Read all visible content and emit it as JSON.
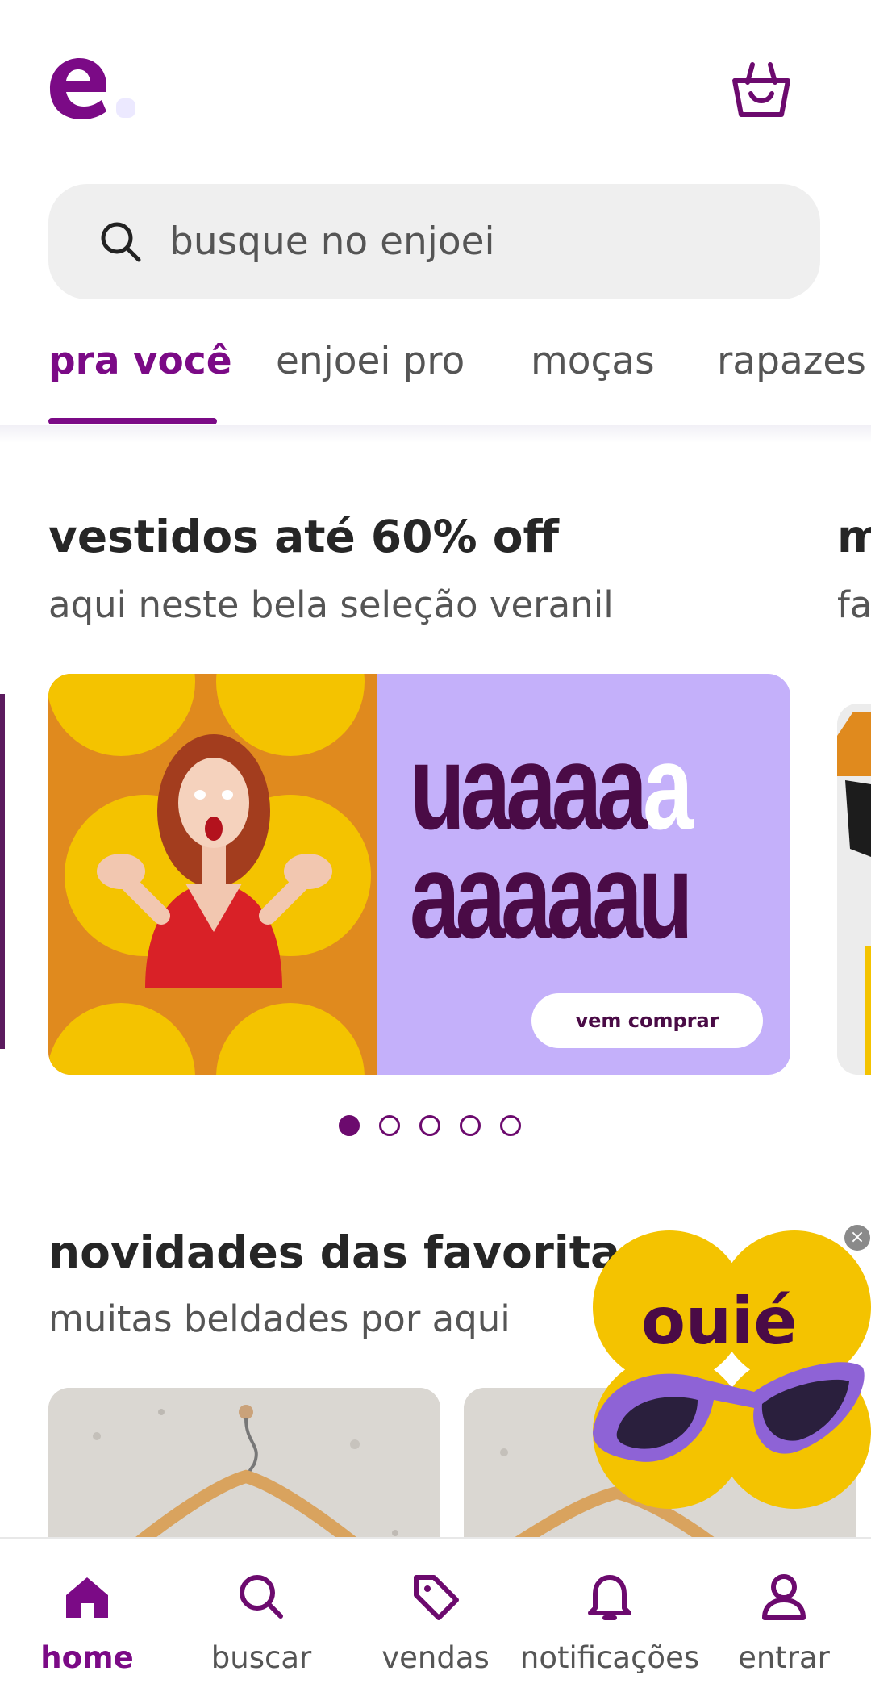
{
  "header": {
    "logo": "enjoei-logo",
    "cart_icon": "shopping-bag-icon"
  },
  "search": {
    "placeholder": "busque no enjoei"
  },
  "tabs": [
    {
      "label": "pra você",
      "active": true
    },
    {
      "label": "enjoei pro"
    },
    {
      "label": "moças"
    },
    {
      "label": "rapazes"
    }
  ],
  "section1": {
    "title": "vestidos até 60% off",
    "subtitle": "aqui neste bela seleção veranil",
    "peek_title": "m",
    "peek_subtitle": "fa",
    "banner": {
      "line1_dark": "uaaaa",
      "line1_light": "a",
      "line2": "aaaaau",
      "cta": "vem comprar",
      "colors": {
        "left": "#e08a1e",
        "right": "#c4b0fa",
        "text": "#4a0b46"
      }
    },
    "carousel": {
      "pages": 5,
      "active_index": 0
    }
  },
  "section2": {
    "title": "novidades das favoritas",
    "subtitle": "muitas beldades por aqui"
  },
  "promo": {
    "text": "ouié",
    "close_icon": "close-icon"
  },
  "bottom_nav": [
    {
      "label": "home",
      "icon": "home-icon",
      "active": true
    },
    {
      "label": "buscar",
      "icon": "search-icon"
    },
    {
      "label": "vendas",
      "icon": "tag-icon"
    },
    {
      "label": "notificações",
      "icon": "bell-icon"
    },
    {
      "label": "entrar",
      "icon": "user-icon"
    }
  ],
  "colors": {
    "brand": "#7b0a86",
    "search_bg": "#efefef"
  }
}
